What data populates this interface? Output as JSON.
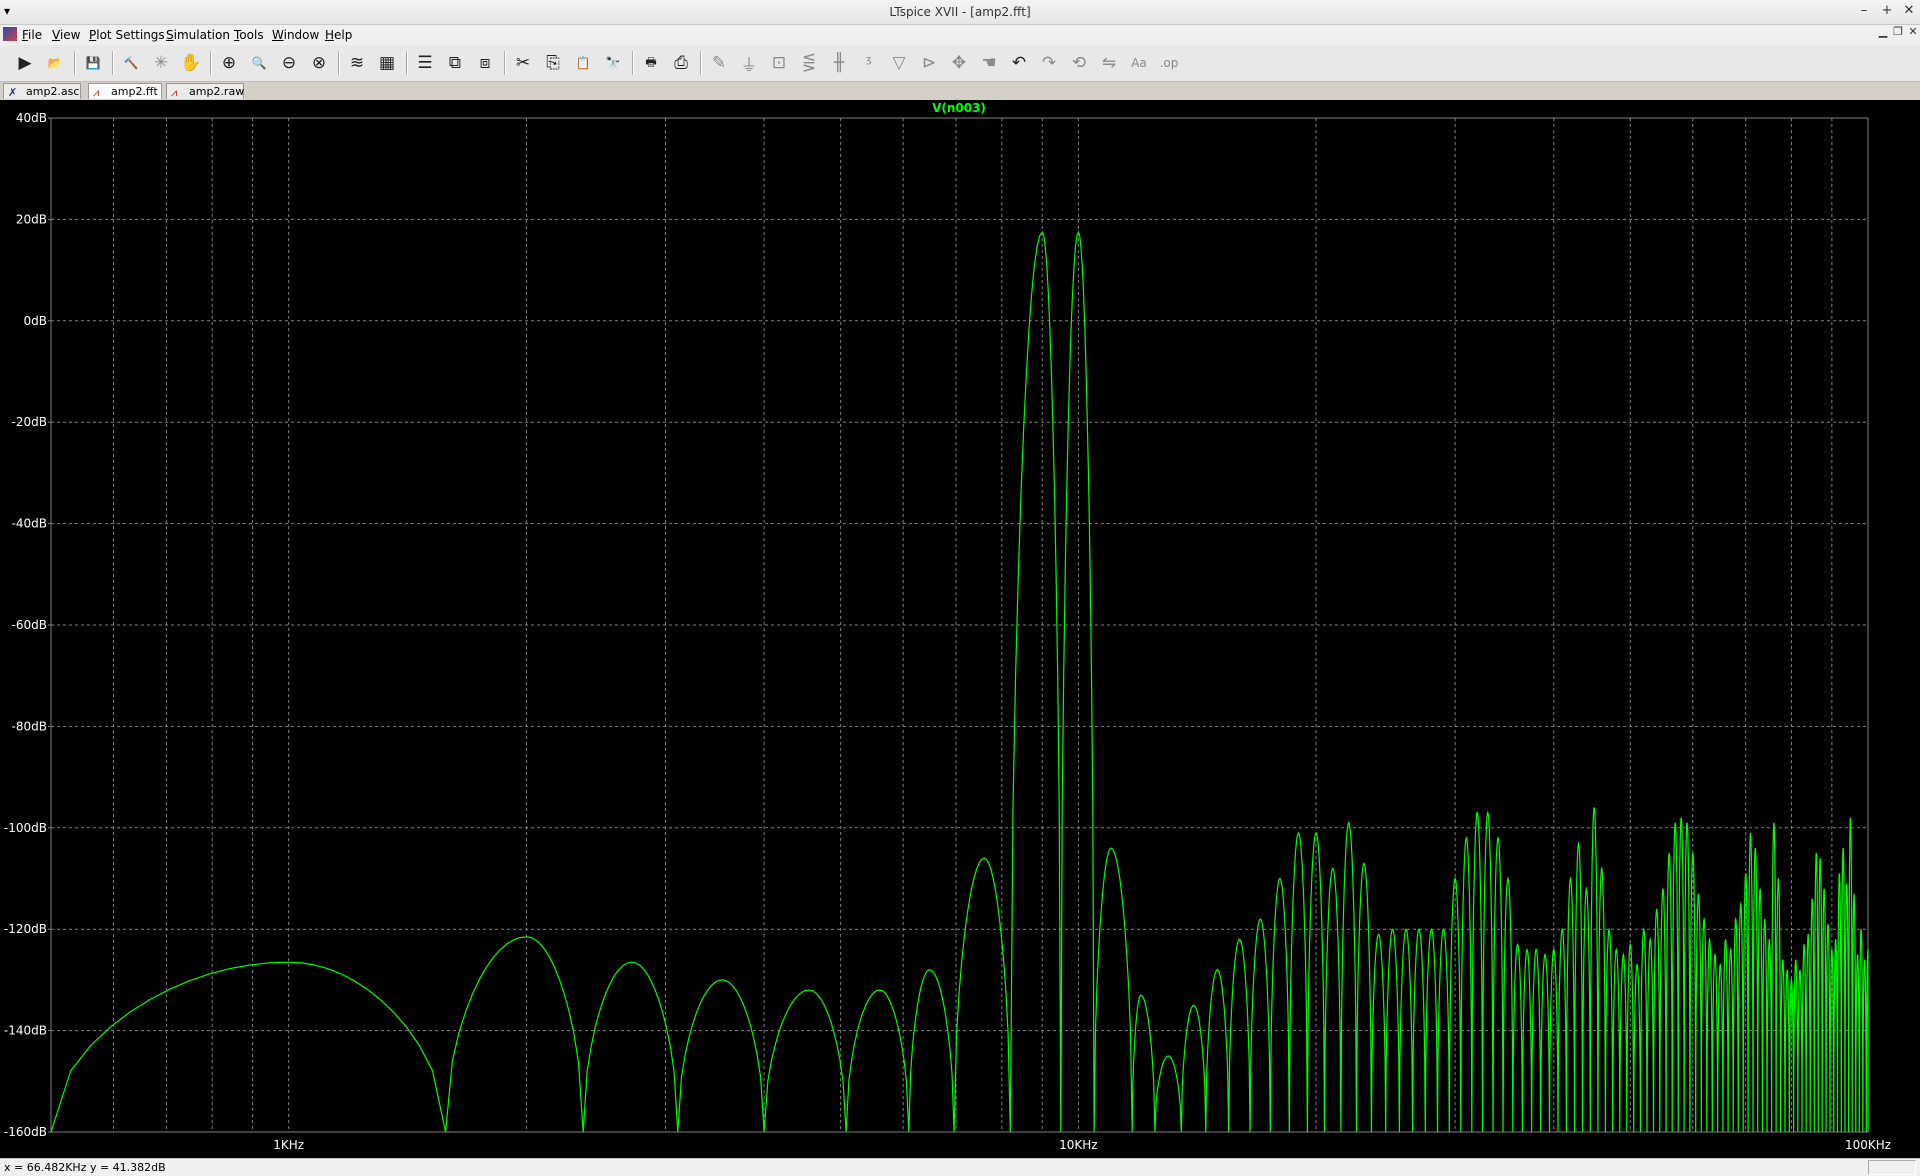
{
  "window": {
    "title": "LTspice XVII - [amp2.fft]",
    "controls": [
      "–",
      "+",
      "✕"
    ]
  },
  "menu": [
    {
      "label": "File",
      "key": "F"
    },
    {
      "label": "View",
      "key": "V"
    },
    {
      "label": "Plot Settings",
      "key": "P"
    },
    {
      "label": "Simulation",
      "key": "S"
    },
    {
      "label": "Tools",
      "key": "T"
    },
    {
      "label": "Window",
      "key": "W"
    },
    {
      "label": "Help",
      "key": "H"
    }
  ],
  "toolbar": [
    {
      "name": "run-icon",
      "glyph": "▶",
      "enabled": true
    },
    {
      "name": "open-icon",
      "glyph": "📂",
      "enabled": true
    },
    {
      "name": "save-icon",
      "glyph": "💾",
      "enabled": true
    },
    {
      "name": "control-panel-icon",
      "glyph": "🔨",
      "enabled": true
    },
    {
      "name": "halt-icon",
      "glyph": "✳",
      "enabled": false
    },
    {
      "name": "pan-icon",
      "glyph": "✋",
      "enabled": false
    },
    {
      "name": "zoom-area-icon",
      "glyph": "⊕",
      "enabled": true
    },
    {
      "name": "zoom-fit-icon",
      "glyph": "🔍",
      "enabled": true
    },
    {
      "name": "zoom-out-icon",
      "glyph": "⊖",
      "enabled": true
    },
    {
      "name": "zoom-cancel-icon",
      "glyph": "⊗",
      "enabled": true
    },
    {
      "name": "autorange-icon",
      "glyph": "≋",
      "enabled": true
    },
    {
      "name": "fit-plot-icon",
      "glyph": "▦",
      "enabled": true
    },
    {
      "name": "tile-horizontal-icon",
      "glyph": "☰",
      "enabled": true
    },
    {
      "name": "cascade-icon",
      "glyph": "⧉",
      "enabled": true
    },
    {
      "name": "tile-vertical-icon",
      "glyph": "⧈",
      "enabled": true
    },
    {
      "name": "cut-icon",
      "glyph": "✂",
      "enabled": true
    },
    {
      "name": "copy-icon",
      "glyph": "⎘",
      "enabled": true
    },
    {
      "name": "paste-icon",
      "glyph": "📋",
      "enabled": true
    },
    {
      "name": "find-icon",
      "glyph": "🔭",
      "enabled": true
    },
    {
      "name": "print-icon",
      "glyph": "🖶",
      "enabled": true
    },
    {
      "name": "print-setup-icon",
      "glyph": "⎙",
      "enabled": true
    },
    {
      "name": "wire-icon",
      "glyph": "✎",
      "enabled": false
    },
    {
      "name": "ground-icon",
      "glyph": "⏚",
      "enabled": false
    },
    {
      "name": "label-net-icon",
      "glyph": "⊡",
      "enabled": false
    },
    {
      "name": "resistor-icon",
      "glyph": "⋚",
      "enabled": false
    },
    {
      "name": "capacitor-icon",
      "glyph": "╫",
      "enabled": false
    },
    {
      "name": "inductor-icon",
      "glyph": "ᶾ",
      "enabled": false
    },
    {
      "name": "diode-icon",
      "glyph": "▽",
      "enabled": false
    },
    {
      "name": "component-icon",
      "glyph": "⊳",
      "enabled": false
    },
    {
      "name": "move-icon",
      "glyph": "✥",
      "enabled": false
    },
    {
      "name": "drag-icon",
      "glyph": "☚",
      "enabled": false
    },
    {
      "name": "undo-icon",
      "glyph": "↶",
      "enabled": true
    },
    {
      "name": "redo-icon",
      "glyph": "↷",
      "enabled": false
    },
    {
      "name": "rotate-icon",
      "glyph": "⟲",
      "enabled": false
    },
    {
      "name": "mirror-icon",
      "glyph": "⇋",
      "enabled": false
    },
    {
      "name": "text-icon",
      "glyph": "Aa",
      "enabled": false
    },
    {
      "name": "spice-directive-icon",
      "glyph": ".op",
      "enabled": false
    }
  ],
  "tabs": [
    {
      "label": "amp2.asc",
      "icon": "schematic-icon",
      "active": false
    },
    {
      "label": "amp2.fft",
      "icon": "waveform-icon",
      "active": true
    },
    {
      "label": "amp2.raw",
      "icon": "waveform-icon",
      "active": false
    }
  ],
  "status": {
    "cursor": "x = 66.482KHz    y = 41.382dB"
  },
  "colors": {
    "plot_bg": "#000000",
    "trace": "#00ff00",
    "grid": "#808080",
    "axis_text": "#ffffff"
  },
  "chart_data": {
    "type": "line",
    "title": "V(n003)",
    "x_scale": "log",
    "x_unit": "Hz",
    "xlim": [
      500,
      100000
    ],
    "ylim": [
      -160,
      40
    ],
    "yticks": [
      "40dB",
      "20dB",
      "0dB",
      "-20dB",
      "-40dB",
      "-60dB",
      "-80dB",
      "-100dB",
      "-120dB",
      "-140dB",
      "-160dB"
    ],
    "xticks": [
      {
        "value": 1000,
        "label": "1KHz"
      },
      {
        "value": 10000,
        "label": "10KHz"
      },
      {
        "value": 100000,
        "label": "100KHz"
      }
    ],
    "grid": true,
    "series": [
      {
        "name": "V(n003)",
        "lobes": [
          {
            "x0": 500,
            "peak": 1000,
            "x1": 1580,
            "y": -126.5
          },
          {
            "x0": 1580,
            "peak": 2000,
            "x1": 2360,
            "y": -121.5
          },
          {
            "x0": 2360,
            "peak": 2720,
            "x1": 3110,
            "y": -126.5
          },
          {
            "x0": 3110,
            "peak": 3540,
            "x1": 4000,
            "y": -130
          },
          {
            "x0": 4000,
            "peak": 4560,
            "x1": 5080,
            "y": -132
          },
          {
            "x0": 5080,
            "peak": 5600,
            "x1": 6100,
            "y": -132
          },
          {
            "x0": 6100,
            "peak": 6480,
            "x1": 6960,
            "y": -128
          },
          {
            "x0": 6960,
            "peak": 7600,
            "x1": 8200,
            "y": -106
          },
          {
            "x0": 8200,
            "peak": 9000,
            "x1": 9500,
            "y": 17.5
          },
          {
            "x0": 9500,
            "peak": 10000,
            "x1": 10470,
            "y": 17.5
          },
          {
            "x0": 10470,
            "peak": 11000,
            "x1": 11700,
            "y": -104
          },
          {
            "x0": 11700,
            "peak": 12000,
            "x1": 12500,
            "y": -133
          },
          {
            "x0": 12500,
            "peak": 13000,
            "x1": 13500,
            "y": -145
          },
          {
            "x0": 13500,
            "peak": 14000,
            "x1": 14500,
            "y": -135
          },
          {
            "x0": 14500,
            "peak": 15000,
            "x1": 15500,
            "y": -128
          },
          {
            "x0": 15500,
            "peak": 16000,
            "x1": 16500,
            "y": -122
          },
          {
            "x0": 16500,
            "peak": 17000,
            "x1": 17500,
            "y": -118
          },
          {
            "x0": 17500,
            "peak": 18000,
            "x1": 18500,
            "y": -110
          },
          {
            "x0": 18500,
            "peak": 19000,
            "x1": 19500,
            "y": -101
          },
          {
            "x0": 19500,
            "peak": 20000,
            "x1": 20500,
            "y": -101
          },
          {
            "x0": 20500,
            "peak": 21000,
            "x1": 21500,
            "y": -108
          },
          {
            "x0": 21500,
            "peak": 22000,
            "x1": 22500,
            "y": -99
          },
          {
            "x0": 22500,
            "peak": 23000,
            "x1": 23500,
            "y": -107
          },
          {
            "x0": 23500,
            "peak": 24000,
            "x1": 24500,
            "y": -121
          },
          {
            "x0": 24500,
            "peak": 25000,
            "x1": 25500,
            "y": -120
          },
          {
            "x0": 25500,
            "peak": 26000,
            "x1": 26500,
            "y": -120
          },
          {
            "x0": 26500,
            "peak": 27000,
            "x1": 27500,
            "y": -120
          },
          {
            "x0": 27500,
            "peak": 28000,
            "x1": 28500,
            "y": -120
          },
          {
            "x0": 28500,
            "peak": 29000,
            "x1": 29500,
            "y": -120
          },
          {
            "x0": 29500,
            "peak": 30000,
            "x1": 30500,
            "y": -110
          },
          {
            "x0": 30500,
            "peak": 31000,
            "x1": 31500,
            "y": -102
          },
          {
            "x0": 31500,
            "peak": 32000,
            "x1": 32500,
            "y": -97
          },
          {
            "x0": 32500,
            "peak": 33000,
            "x1": 33500,
            "y": -97
          },
          {
            "x0": 33500,
            "peak": 34000,
            "x1": 34500,
            "y": -102
          },
          {
            "x0": 34500,
            "peak": 35000,
            "x1": 35500,
            "y": -110
          },
          {
            "x0": 35500,
            "peak": 36000,
            "x1": 36500,
            "y": -123
          },
          {
            "x0": 36500,
            "peak": 37000,
            "x1": 37500,
            "y": -124
          },
          {
            "x0": 37500,
            "peak": 38000,
            "x1": 38500,
            "y": -124
          },
          {
            "x0": 38500,
            "peak": 39000,
            "x1": 39500,
            "y": -125
          },
          {
            "x0": 39500,
            "peak": 40000,
            "x1": 40500,
            "y": -124
          },
          {
            "x0": 40500,
            "peak": 41000,
            "x1": 41500,
            "y": -120
          },
          {
            "x0": 41500,
            "peak": 42000,
            "x1": 42500,
            "y": -110
          },
          {
            "x0": 42500,
            "peak": 43000,
            "x1": 43500,
            "y": -103
          },
          {
            "x0": 43500,
            "peak": 44000,
            "x1": 44500,
            "y": -112
          },
          {
            "x0": 44500,
            "peak": 45000,
            "x1": 45500,
            "y": -96
          },
          {
            "x0": 45500,
            "peak": 46000,
            "x1": 46500,
            "y": -108
          },
          {
            "x0": 46500,
            "peak": 47000,
            "x1": 47500,
            "y": -120
          },
          {
            "x0": 47500,
            "peak": 48000,
            "x1": 48500,
            "y": -124
          },
          {
            "x0": 48500,
            "peak": 49000,
            "x1": 49500,
            "y": -125
          },
          {
            "x0": 49500,
            "peak": 50000,
            "x1": 50500,
            "y": -123
          },
          {
            "x0": 50500,
            "peak": 51000,
            "x1": 51500,
            "y": -127
          },
          {
            "x0": 51500,
            "peak": 52000,
            "x1": 52500,
            "y": -120
          },
          {
            "x0": 52500,
            "peak": 53000,
            "x1": 53500,
            "y": -122
          },
          {
            "x0": 53500,
            "peak": 54000,
            "x1": 54500,
            "y": -116
          },
          {
            "x0": 54500,
            "peak": 55000,
            "x1": 55500,
            "y": -112
          },
          {
            "x0": 55500,
            "peak": 56000,
            "x1": 56500,
            "y": -105
          },
          {
            "x0": 56500,
            "peak": 57000,
            "x1": 57500,
            "y": -99
          },
          {
            "x0": 57500,
            "peak": 58000,
            "x1": 58500,
            "y": -98
          },
          {
            "x0": 58500,
            "peak": 59000,
            "x1": 59500,
            "y": -99
          },
          {
            "x0": 59500,
            "peak": 60000,
            "x1": 60500,
            "y": -105
          },
          {
            "x0": 60500,
            "peak": 61000,
            "x1": 61500,
            "y": -113
          },
          {
            "x0": 61500,
            "peak": 62000,
            "x1": 62500,
            "y": -118
          },
          {
            "x0": 62500,
            "peak": 63000,
            "x1": 63500,
            "y": -122
          },
          {
            "x0": 63500,
            "peak": 64000,
            "x1": 64500,
            "y": -125
          },
          {
            "x0": 64500,
            "peak": 65000,
            "x1": 65500,
            "y": -127
          },
          {
            "x0": 65500,
            "peak": 66000,
            "x1": 66500,
            "y": -122
          },
          {
            "x0": 66500,
            "peak": 67000,
            "x1": 67500,
            "y": -124
          },
          {
            "x0": 67500,
            "peak": 68000,
            "x1": 68500,
            "y": -118
          },
          {
            "x0": 68500,
            "peak": 69000,
            "x1": 69500,
            "y": -115
          },
          {
            "x0": 69500,
            "peak": 70000,
            "x1": 70500,
            "y": -109
          },
          {
            "x0": 70500,
            "peak": 71000,
            "x1": 71500,
            "y": -101
          },
          {
            "x0": 71500,
            "peak": 72000,
            "x1": 72500,
            "y": -104
          },
          {
            "x0": 72500,
            "peak": 73000,
            "x1": 73500,
            "y": -112
          },
          {
            "x0": 73500,
            "peak": 74000,
            "x1": 74500,
            "y": -118
          },
          {
            "x0": 74500,
            "peak": 75000,
            "x1": 75500,
            "y": -122
          },
          {
            "x0": 75500,
            "peak": 76000,
            "x1": 76500,
            "y": -99
          },
          {
            "x0": 76500,
            "peak": 77000,
            "x1": 77500,
            "y": -110
          },
          {
            "x0": 77500,
            "peak": 78000,
            "x1": 78500,
            "y": -126
          },
          {
            "x0": 78500,
            "peak": 79000,
            "x1": 79500,
            "y": -128
          },
          {
            "x0": 79500,
            "peak": 80000,
            "x1": 80500,
            "y": -130
          },
          {
            "x0": 80500,
            "peak": 81000,
            "x1": 81500,
            "y": -126
          },
          {
            "x0": 81500,
            "peak": 82000,
            "x1": 82500,
            "y": -128
          },
          {
            "x0": 82500,
            "peak": 83000,
            "x1": 83500,
            "y": -123
          },
          {
            "x0": 83500,
            "peak": 84000,
            "x1": 84500,
            "y": -121
          },
          {
            "x0": 84500,
            "peak": 85000,
            "x1": 85500,
            "y": -114
          },
          {
            "x0": 85500,
            "peak": 86000,
            "x1": 86500,
            "y": -105
          },
          {
            "x0": 86500,
            "peak": 87000,
            "x1": 87500,
            "y": -106
          },
          {
            "x0": 87500,
            "peak": 88000,
            "x1": 88500,
            "y": -112
          },
          {
            "x0": 88500,
            "peak": 89000,
            "x1": 89500,
            "y": -119
          },
          {
            "x0": 89500,
            "peak": 90000,
            "x1": 90500,
            "y": -124
          },
          {
            "x0": 90500,
            "peak": 91000,
            "x1": 91500,
            "y": -122
          },
          {
            "x0": 91500,
            "peak": 92000,
            "x1": 92500,
            "y": -109
          },
          {
            "x0": 92500,
            "peak": 93000,
            "x1": 93500,
            "y": -104
          },
          {
            "x0": 93500,
            "peak": 94000,
            "x1": 94500,
            "y": -111
          },
          {
            "x0": 94500,
            "peak": 95000,
            "x1": 95500,
            "y": -98
          },
          {
            "x0": 95500,
            "peak": 96000,
            "x1": 96500,
            "y": -113
          },
          {
            "x0": 96500,
            "peak": 97000,
            "x1": 97500,
            "y": -125
          },
          {
            "x0": 97500,
            "peak": 98000,
            "x1": 98500,
            "y": -120
          },
          {
            "x0": 98500,
            "peak": 99000,
            "x1": 99500,
            "y": -126
          },
          {
            "x0": 99500,
            "peak": 100000,
            "x1": 100000,
            "y": -124
          }
        ]
      }
    ]
  }
}
